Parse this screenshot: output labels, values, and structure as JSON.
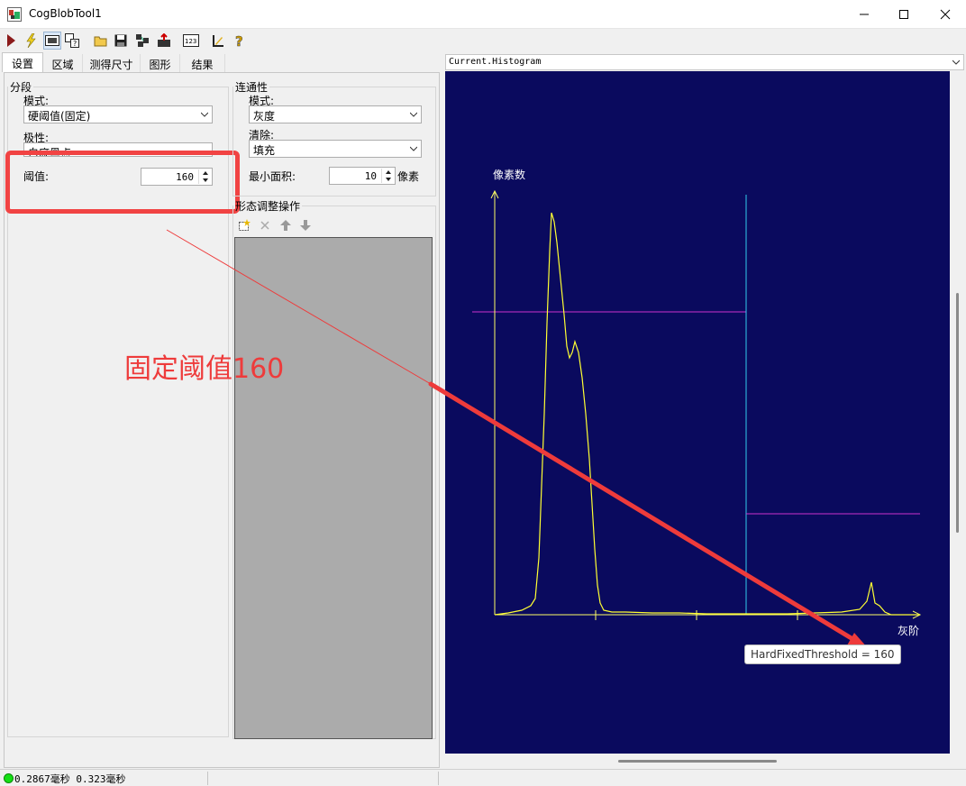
{
  "window": {
    "title": "CogBlobTool1"
  },
  "tabs": [
    {
      "label": "设置"
    },
    {
      "label": "区域"
    },
    {
      "label": "测得尺寸"
    },
    {
      "label": "图形"
    },
    {
      "label": "结果"
    }
  ],
  "segmentation": {
    "legend": "分段",
    "mode_label": "模式:",
    "mode_value": "硬阈值(固定)",
    "polarity_label": "极性:",
    "polarity_value": "白底黑点",
    "threshold_label": "阈值:",
    "threshold_value": "160"
  },
  "connectivity": {
    "legend": "连通性",
    "mode_label": "模式:",
    "mode_value": "灰度",
    "cleanup_label": "清除:",
    "cleanup_value": "填充",
    "min_area_label": "最小面积:",
    "min_area_value": "10",
    "min_area_unit": "像素"
  },
  "morphology": {
    "legend": "形态调整操作"
  },
  "histogram": {
    "selector_value": "Current.Histogram",
    "y_axis_label": "像素数",
    "x_axis_label": "灰阶",
    "tooltip": "HardFixedThreshold = 160",
    "colors": {
      "background": "#0a0a5e",
      "curve": "#ffff33",
      "threshold_line": "#33ccee",
      "step_line": "#cc33cc",
      "axis": "#ffff66"
    }
  },
  "annotation": {
    "text": "固定阈值160",
    "color": "#ee3b3b"
  },
  "status": {
    "timing": "0.2867毫秒 0.323毫秒"
  }
}
